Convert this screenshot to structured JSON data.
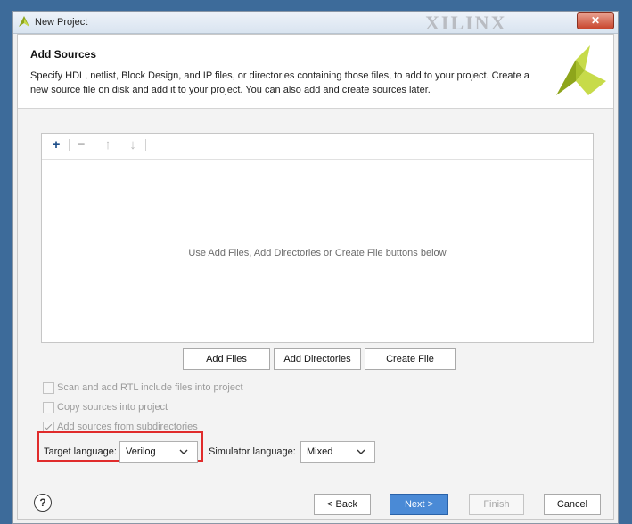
{
  "window": {
    "title": "New Project",
    "watermark": "XILINX",
    "close_label": "✕"
  },
  "header": {
    "title": "Add Sources",
    "description": "Specify HDL, netlist, Block Design, and IP files, or directories containing those files, to add to your project. Create a new source file on disk and add it to your project. You can also add and create sources later."
  },
  "toolbar": {
    "icons": [
      "add-icon",
      "remove-icon",
      "move-up-icon",
      "move-down-icon"
    ]
  },
  "sources": {
    "empty_message": "Use Add Files, Add Directories or Create File buttons below",
    "buttons": {
      "add_files": "Add Files",
      "add_directories": "Add Directories",
      "create_file": "Create File"
    }
  },
  "options": [
    {
      "label": "Scan and add RTL include files into project",
      "checked": false
    },
    {
      "label": "Copy sources into project",
      "checked": false
    },
    {
      "label": "Add sources from subdirectories",
      "checked": true
    }
  ],
  "target_language": {
    "label": "Target language:",
    "value": "Verilog"
  },
  "simulator_language": {
    "label": "Simulator language:",
    "value": "Mixed"
  },
  "footer": {
    "help": "?",
    "back": "< Back",
    "next": "Next >",
    "finish": "Finish",
    "cancel": "Cancel"
  },
  "colors": {
    "accent": "#4a8ad6",
    "highlight": "#e02b2b",
    "logo_dark": "#8ea51b",
    "logo_light": "#c7db4a"
  }
}
